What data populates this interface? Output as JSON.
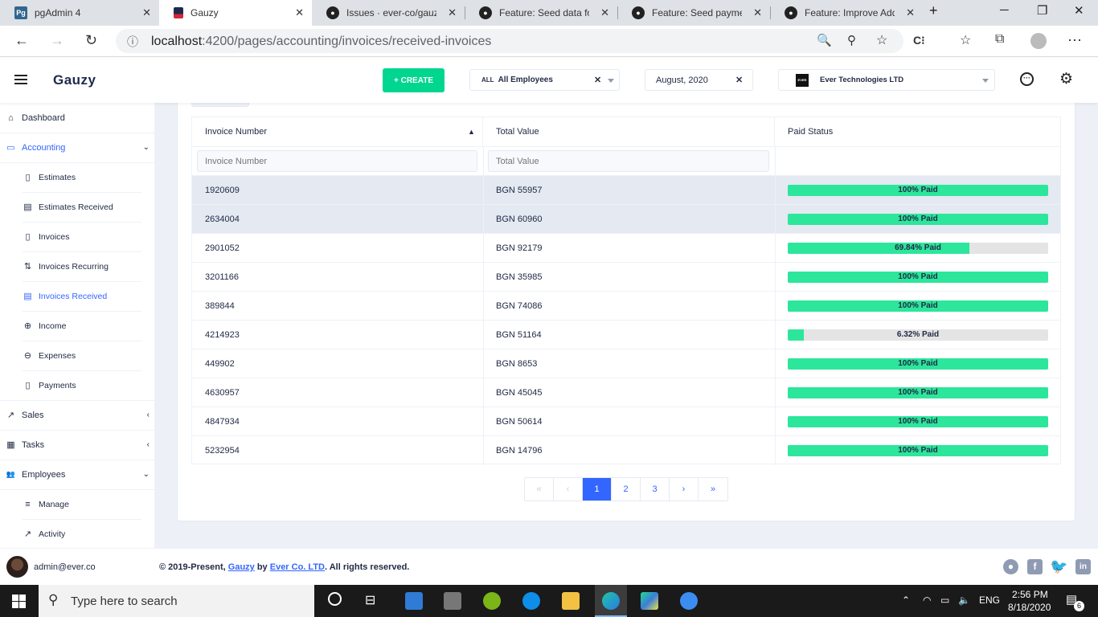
{
  "browser": {
    "tabs": [
      {
        "title": "pgAdmin 4",
        "icon": "pgadmin-icon",
        "favtext": "Pg"
      },
      {
        "title": "Gauzy",
        "icon": "gauzy-icon",
        "favtext": ""
      },
      {
        "title": "Issues · ever-co/gauzy",
        "icon": "github-icon",
        "favtext": ""
      },
      {
        "title": "Feature: Seed data for T",
        "icon": "github-icon",
        "favtext": ""
      },
      {
        "title": "Feature: Seed payment",
        "icon": "github-icon",
        "favtext": ""
      },
      {
        "title": "Feature: Improve Add E",
        "icon": "github-icon",
        "favtext": ""
      }
    ],
    "url_host": "localhost",
    "url_path": ":4200/pages/accounting/invoices/received-invoices"
  },
  "header": {
    "logo": "Gauzy",
    "create_label": "+ CREATE",
    "employee_badge": "ALL",
    "employee_value": "All Employees",
    "date_value": "August, 2020",
    "org_badge": "EVER",
    "org_value": "Ever Technologies LTD"
  },
  "sidebar": {
    "items": [
      {
        "label": "Dashboard",
        "icon": "home-icon",
        "glyph": "⌂"
      },
      {
        "label": "Accounting",
        "icon": "credit-card-icon",
        "glyph": "▭"
      },
      {
        "label": "Estimates",
        "icon": "file-icon",
        "glyph": "▯"
      },
      {
        "label": "Estimates Received",
        "icon": "archive-icon",
        "glyph": "▤"
      },
      {
        "label": "Invoices",
        "icon": "file-text-icon",
        "glyph": "▯"
      },
      {
        "label": "Invoices Recurring",
        "icon": "recurring-icon",
        "glyph": "⇅"
      },
      {
        "label": "Invoices Received",
        "icon": "archive-icon",
        "glyph": "▤"
      },
      {
        "label": "Income",
        "icon": "plus-circle-icon",
        "glyph": "⊕"
      },
      {
        "label": "Expenses",
        "icon": "minus-circle-icon",
        "glyph": "⊖"
      },
      {
        "label": "Payments",
        "icon": "clipboard-icon",
        "glyph": "▯"
      },
      {
        "label": "Sales",
        "icon": "trending-up-icon",
        "glyph": "↗"
      },
      {
        "label": "Tasks",
        "icon": "calendar-icon",
        "glyph": "▦"
      },
      {
        "label": "Employees",
        "icon": "people-icon",
        "glyph": "👥"
      },
      {
        "label": "Manage",
        "icon": "menu-icon",
        "glyph": "≡"
      },
      {
        "label": "Activity",
        "icon": "trending-up-icon",
        "glyph": "↗"
      }
    ]
  },
  "table": {
    "columns": [
      "Invoice Number",
      "Total Value",
      "Paid Status"
    ],
    "filters": {
      "invoice_placeholder": "Invoice Number",
      "total_placeholder": "Total Value"
    },
    "rows": [
      {
        "number": "1920609",
        "total": "BGN 55957",
        "paid_pct": 100,
        "paid_label": "100% Paid"
      },
      {
        "number": "2634004",
        "total": "BGN 60960",
        "paid_pct": 100,
        "paid_label": "100% Paid"
      },
      {
        "number": "2901052",
        "total": "BGN 92179",
        "paid_pct": 69.84,
        "paid_label": "69.84% Paid"
      },
      {
        "number": "3201166",
        "total": "BGN 35985",
        "paid_pct": 100,
        "paid_label": "100% Paid"
      },
      {
        "number": "389844",
        "total": "BGN 74086",
        "paid_pct": 100,
        "paid_label": "100% Paid"
      },
      {
        "number": "4214923",
        "total": "BGN 51164",
        "paid_pct": 6.32,
        "paid_label": "6.32% Paid"
      },
      {
        "number": "449902",
        "total": "BGN 8653",
        "paid_pct": 100,
        "paid_label": "100% Paid"
      },
      {
        "number": "4630957",
        "total": "BGN 45045",
        "paid_pct": 100,
        "paid_label": "100% Paid"
      },
      {
        "number": "4847934",
        "total": "BGN 50614",
        "paid_pct": 100,
        "paid_label": "100% Paid"
      },
      {
        "number": "5232954",
        "total": "BGN 14796",
        "paid_pct": 100,
        "paid_label": "100% Paid"
      }
    ]
  },
  "pager": {
    "first": "«",
    "prev": "‹",
    "pages": [
      "1",
      "2",
      "3"
    ],
    "next": "›",
    "last": "»",
    "current": "1"
  },
  "footer": {
    "user": "admin@ever.co",
    "copy_prefix": "© 2019-Present, ",
    "brand": "Gauzy",
    "by": " by ",
    "company": "Ever Co. LTD",
    "suffix": ". All rights reserved."
  },
  "taskbar": {
    "search_placeholder": "Type here to search",
    "lang": "ENG",
    "time": "2:56 PM",
    "date": "8/18/2020",
    "notif_count": "6"
  },
  "colors": {
    "accent": "#3366ff",
    "success": "#00d68f",
    "progress": "#2ce69b"
  }
}
